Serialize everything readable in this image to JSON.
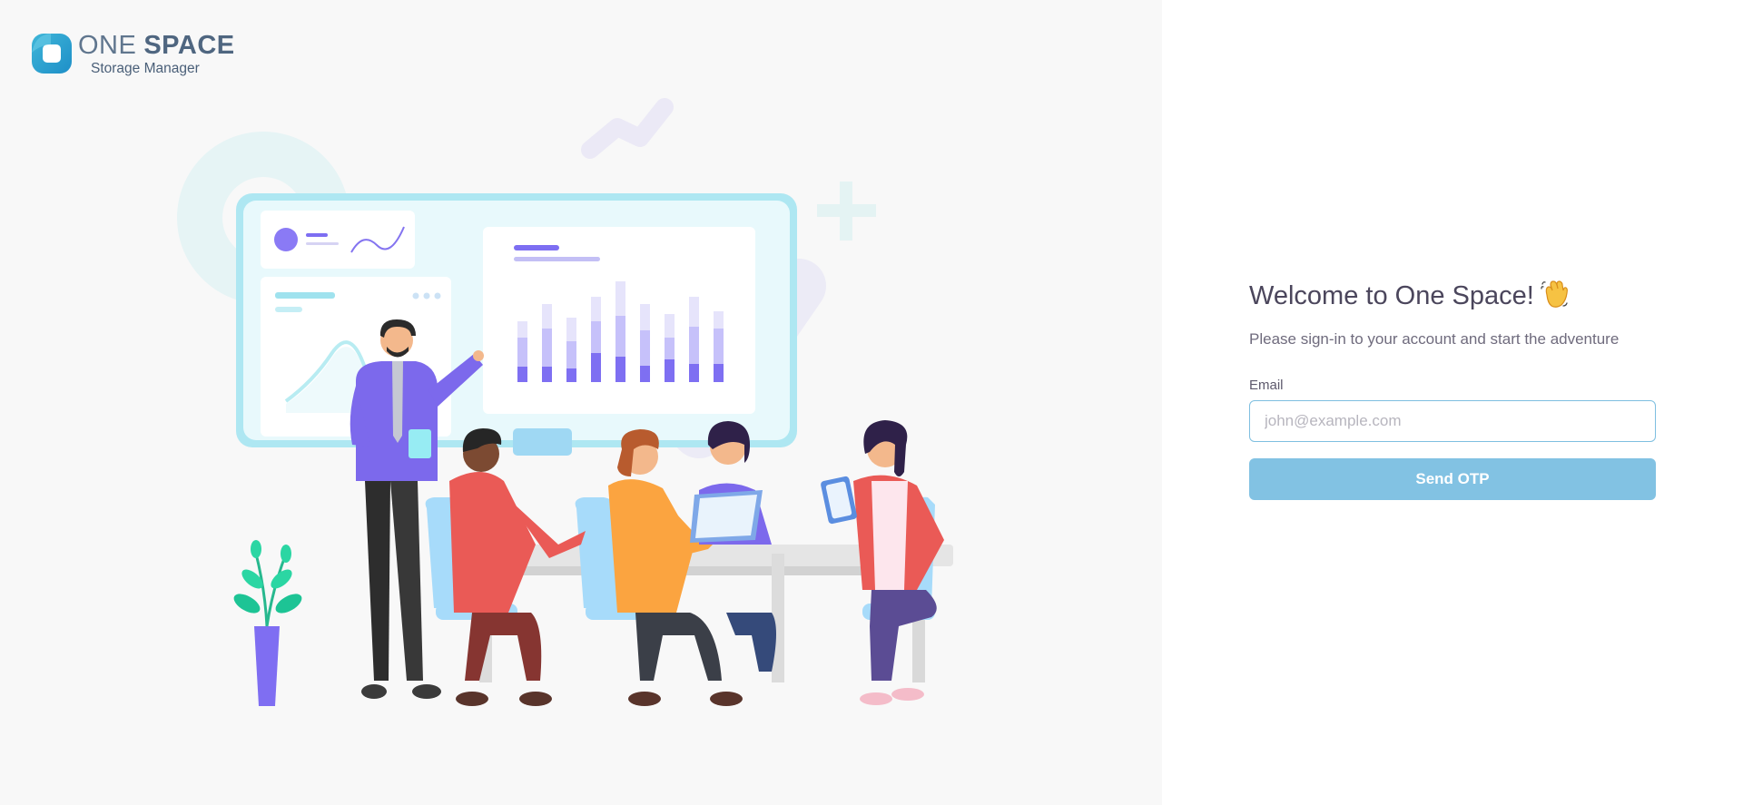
{
  "brand": {
    "name_part1": "ONE",
    "name_part2": "SPACE",
    "subtitle": "Storage Manager",
    "logo_icon": "rounded-square-logo-icon",
    "color": "#4a5f78"
  },
  "illustration": {
    "icon": "team-meeting-illustration"
  },
  "auth": {
    "title": "Welcome to One Space!",
    "title_icon": "waving-hand-icon",
    "subtitle": "Please sign-in to your account and start the adventure",
    "email_label": "Email",
    "email_value": "",
    "email_placeholder": "john@example.com",
    "submit_label": "Send OTP"
  },
  "colors": {
    "left_background": "#f8f8f8",
    "primary_button": "#82c2e3",
    "input_border": "#7ebfe0",
    "accent_purple": "#7367f0"
  }
}
